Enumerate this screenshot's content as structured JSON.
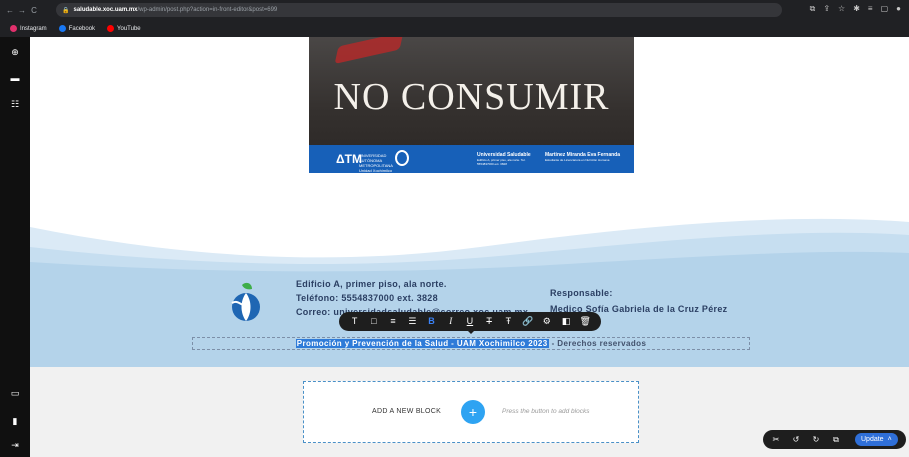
{
  "browser": {
    "url_host": "saludable.xoc.uam.mx",
    "url_path": "/wp-admin/post.php?action=in-front-editor&post=699",
    "bookmarks": [
      {
        "label": "Instagram",
        "color": "#e1306c"
      },
      {
        "label": "Facebook",
        "color": "#1877f2"
      },
      {
        "label": "YouTube",
        "color": "#ff0000"
      }
    ]
  },
  "poster": {
    "title": "NO CONSUMIR",
    "band": {
      "uam_name": "UNIVERSIDAD AUTÓNOMA METROPOLITANA Unidad Xochimilco",
      "us_title": "Universidad Saludable",
      "us_sub": "Edificio A, primer piso, ala norte. Tel. 5554837000 ext. 3828",
      "author_title": "Martinez Miranda Eva Fernanda",
      "author_sub": "Estudiante de Licenciatura en Nutrición Humana"
    }
  },
  "footer": {
    "address_line1": "Edificio A, primer piso, ala norte.",
    "address_line2": "Teléfono: 5554837000 ext. 3828",
    "address_line3": "Correo: universidadsaludable@correo.xoc.uam.mx",
    "resp_label": "Responsable:",
    "resp_name": "Medico Sofía Gabriela de la Cruz Pérez",
    "copyright_selected": "Promoción y Prevención de la Salud - UAM Xochimilco 2023",
    "copyright_rest": "- Derechos reservados"
  },
  "toolbar": {
    "items": [
      "T",
      "□",
      "≡",
      "☰",
      "B",
      "I",
      "U",
      "T",
      "Ŧ",
      "🔗",
      "⚙",
      "◧",
      "🗑"
    ]
  },
  "add_block": {
    "label": "ADD A NEW BLOCK",
    "hint": "Press the button to add blocks"
  },
  "bottom_bar": {
    "update_label": "Update"
  }
}
